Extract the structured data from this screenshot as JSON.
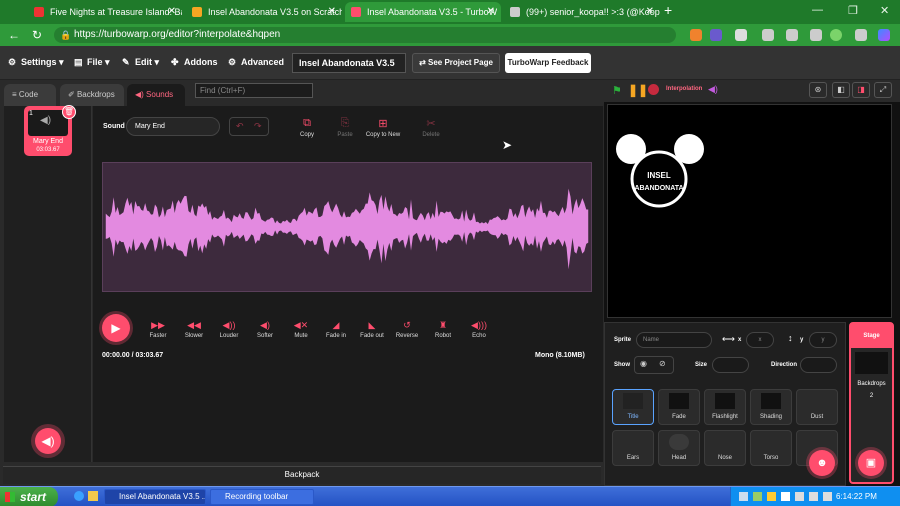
{
  "browser": {
    "tabs": [
      {
        "title": "Five Nights at Treasure Island: Ba"
      },
      {
        "title": "Insel Abandonata V3.5 on Scratch"
      },
      {
        "title": "Insel Abandonata V3.5 - TurboW"
      },
      {
        "title": "(99+) senior_koopa!! >:3 (@Koop"
      }
    ],
    "url": "https://turbowarp.org/editor?interpolate&hqpen"
  },
  "menubar": {
    "settings": "Settings",
    "file": "File",
    "edit": "Edit",
    "addons": "Addons",
    "advanced": "Advanced",
    "project_title": "Insel Abandonata V3.5",
    "see_project": "See Project Page",
    "feedback": "TurboWarp Feedback"
  },
  "editor_tabs": {
    "code": "Code",
    "backdrops": "Backdrops",
    "sounds": "Sounds"
  },
  "find": {
    "placeholder": "Find (Ctrl+F)"
  },
  "sound_list": [
    {
      "index": "1",
      "name": "Mary End",
      "duration": "03:03.67"
    }
  ],
  "sound_editor": {
    "sound_label": "Sound",
    "sound_name": "Mary End",
    "tools": [
      {
        "label": "Copy",
        "icon": "copy-icon"
      },
      {
        "label": "Paste",
        "icon": "paste-icon"
      },
      {
        "label": "Copy to New",
        "icon": "copy-to-new-icon"
      },
      {
        "label": "Delete",
        "icon": "delete-icon"
      }
    ],
    "effects": [
      {
        "label": "Faster"
      },
      {
        "label": "Slower"
      },
      {
        "label": "Louder"
      },
      {
        "label": "Softer"
      },
      {
        "label": "Mute"
      },
      {
        "label": "Fade in"
      },
      {
        "label": "Fade out"
      },
      {
        "label": "Reverse"
      },
      {
        "label": "Robot"
      },
      {
        "label": "Echo"
      }
    ],
    "time": "00:00.00 / 03:03.67",
    "format": "Mono (8.10MB)",
    "waveform_color": "#e38ae0"
  },
  "backpack": "Backpack",
  "stage": {
    "interpolation": "Interpolation",
    "logo_line1": "INSEL",
    "logo_line2": "ABANDONATA"
  },
  "sprite_info": {
    "sprite_label": "Sprite",
    "name_placeholder": "Name",
    "x_label": "x",
    "x_placeholder": "x",
    "y_label": "y",
    "y_placeholder": "y",
    "show_label": "Show",
    "size_label": "Size",
    "direction_label": "Direction"
  },
  "sprites": [
    {
      "name": "Title"
    },
    {
      "name": "Fade"
    },
    {
      "name": "Flashlight"
    },
    {
      "name": "Shading"
    },
    {
      "name": "Dust"
    },
    {
      "name": "Ears"
    },
    {
      "name": "Head"
    },
    {
      "name": "Nose"
    },
    {
      "name": "Torso"
    }
  ],
  "stage_panel": {
    "title": "Stage",
    "backdrops_label": "Backdrops",
    "backdrops_count": "2"
  },
  "taskbar": {
    "start": "start",
    "windows": [
      {
        "title": "Insel Abandonata V3.5 ..."
      },
      {
        "title": "Recording toolbar"
      }
    ],
    "clock": "6:14:22 PM"
  },
  "colors": {
    "accent": "#ff4d6d",
    "browser_green": "#2f9a3a"
  }
}
